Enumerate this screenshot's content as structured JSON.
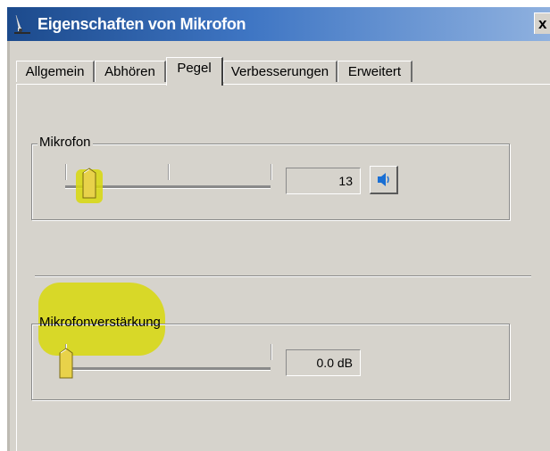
{
  "window": {
    "title": "Eigenschaften von Mikrofon",
    "close_label": "x",
    "icon": "microphone-icon"
  },
  "tabs": [
    {
      "label": "Allgemein",
      "active": false
    },
    {
      "label": "Abhören",
      "active": false
    },
    {
      "label": "Pegel",
      "active": true
    },
    {
      "label": "Verbesserungen",
      "active": false
    },
    {
      "label": "Erweitert",
      "active": false
    }
  ],
  "mikrofon": {
    "label": "Mikrofon",
    "value": "13",
    "level": 0.13,
    "speaker_icon": "speaker-icon"
  },
  "verstaerkung": {
    "label": "Mikrofonverstärkung",
    "value": "0.0 dB",
    "level": 0.0
  },
  "colors": {
    "titlebar_start": "#1c4a8c",
    "highlight": "#d8d80a",
    "face": "#d6d3cc"
  }
}
